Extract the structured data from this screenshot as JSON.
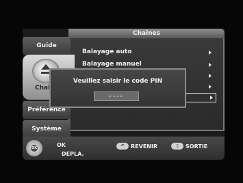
{
  "header": {
    "title": "Chaînes"
  },
  "tabs": [
    {
      "label": "Guide"
    },
    {
      "label": "Chaînes"
    },
    {
      "label": "Préférence"
    },
    {
      "label": "Système"
    }
  ],
  "menu": {
    "items": [
      {
        "label": "Balayage auto"
      },
      {
        "label": "Balayage manuel"
      }
    ]
  },
  "dialog": {
    "message": "Veuillez saisir le code PIN",
    "pin_value": "----"
  },
  "footer": {
    "ok_label": "OK",
    "move_label": "DEPLA.",
    "back_label": "REVENIR",
    "exit_label": "SORTIE",
    "dpad_center": "OK"
  }
}
